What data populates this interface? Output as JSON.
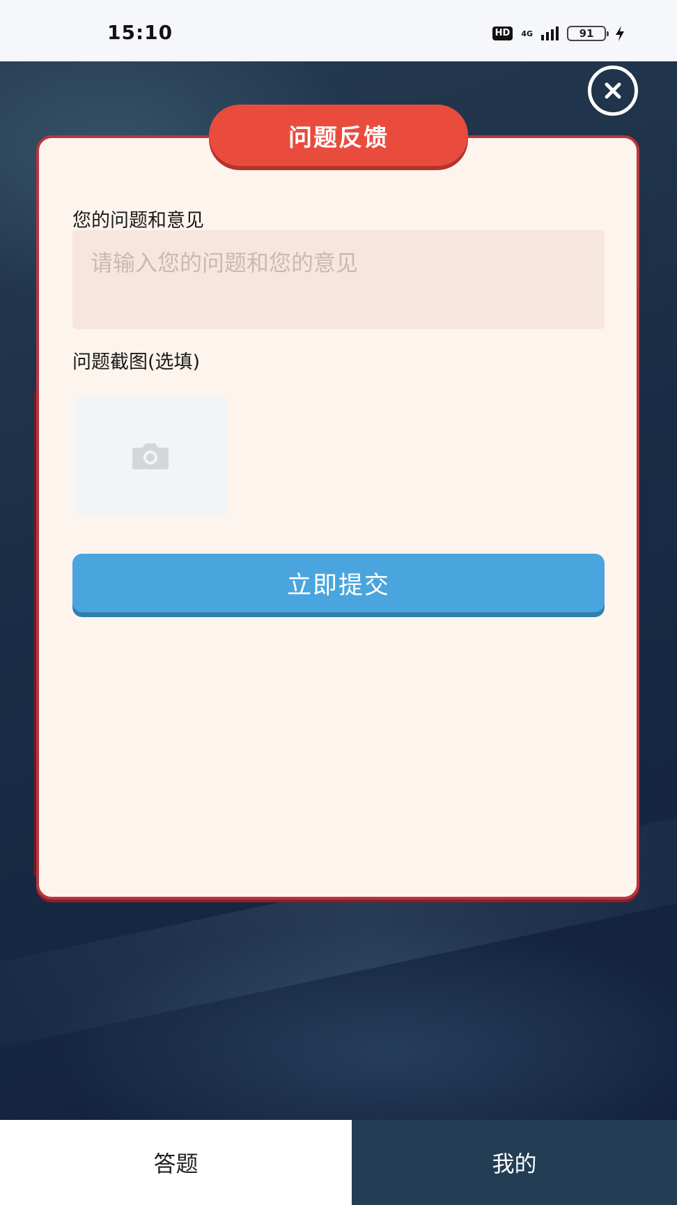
{
  "status_bar": {
    "time": "15:10",
    "hd": "HD",
    "network": "4G",
    "battery": "91"
  },
  "dialog": {
    "title": "问题反馈",
    "problem_label": "您的问题和意见",
    "problem_placeholder": "请输入您的问题和您的意见",
    "problem_value": "",
    "screenshot_label": "问题截图(选填)",
    "submit_label": "立即提交",
    "close_icon": "close-circle-icon",
    "upload_icon": "camera-icon"
  },
  "tabs": [
    {
      "label": "答题",
      "active": false
    },
    {
      "label": "我的",
      "active": true
    }
  ],
  "colors": {
    "header_red": "#e94c3d",
    "card_border": "#b9353f",
    "card_bg": "#fdf4ee",
    "submit_blue": "#4aa5de",
    "tab_active_bg": "#233d55"
  }
}
